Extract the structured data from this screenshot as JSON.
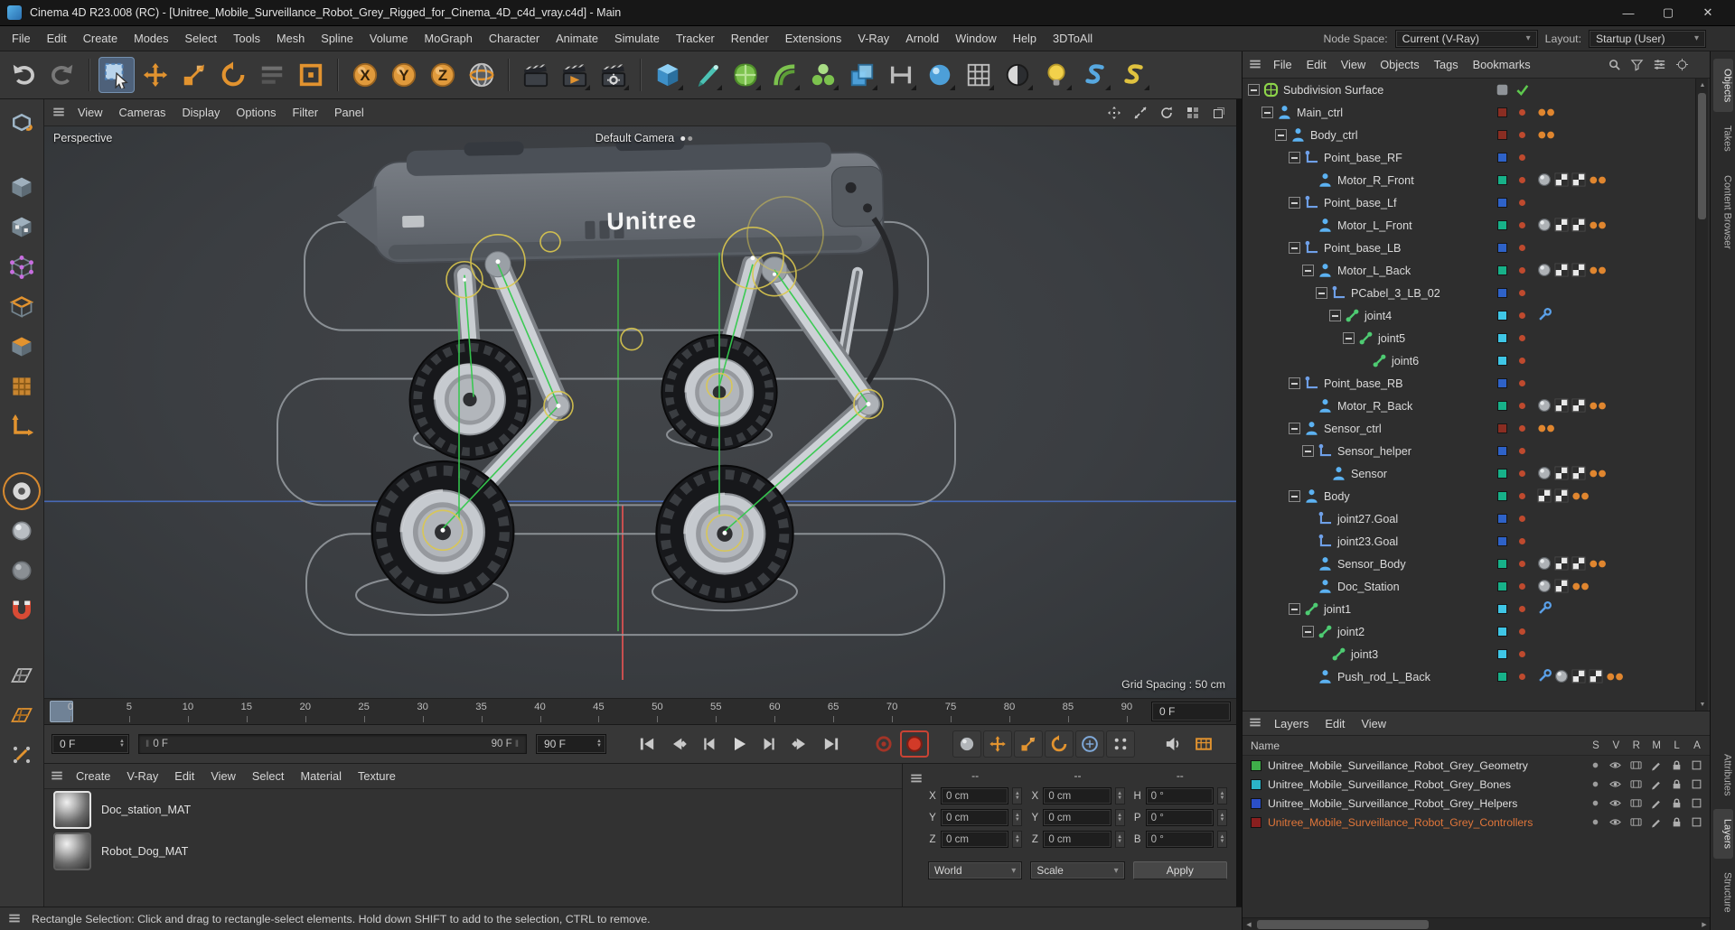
{
  "window": {
    "title": "Cinema 4D R23.008 (RC) - [Unitree_Mobile_Surveillance_Robot_Grey_Rigged_for_Cinema_4D_c4d_vray.c4d] - Main",
    "buttons": [
      {
        "name": "minimize",
        "glyph": "—"
      },
      {
        "name": "maximize",
        "glyph": "▢"
      },
      {
        "name": "close",
        "glyph": "✕"
      }
    ]
  },
  "menu_bar": {
    "items": [
      "File",
      "Edit",
      "Create",
      "Modes",
      "Select",
      "Tools",
      "Mesh",
      "Spline",
      "Volume",
      "MoGraph",
      "Character",
      "Animate",
      "Simulate",
      "Tracker",
      "Render",
      "Extensions",
      "V-Ray",
      "Arnold",
      "Window",
      "Help",
      "3DToAll"
    ],
    "node_space_label": "Node Space:",
    "node_space_value": "Current (V-Ray)",
    "layout_label": "Layout:",
    "layout_value": "Startup (User)"
  },
  "toolbar": {
    "tools": [
      {
        "name": "undo",
        "icon": "undo"
      },
      {
        "name": "redo",
        "icon": "redo"
      },
      {
        "sep": true
      },
      {
        "name": "live-selection",
        "icon": "live-selection",
        "selected": true
      },
      {
        "name": "move-tool",
        "icon": "move"
      },
      {
        "name": "scale-tool",
        "icon": "scale"
      },
      {
        "name": "rotate-tool",
        "icon": "rotate"
      },
      {
        "name": "last-used-tool",
        "icon": "last-tool"
      },
      {
        "name": "workplane-tool",
        "icon": "workplane"
      },
      {
        "sep": true
      },
      {
        "name": "x-axis-lock",
        "icon": "axis",
        "letter": "X"
      },
      {
        "name": "y-axis-lock",
        "icon": "axis",
        "letter": "Y"
      },
      {
        "name": "z-axis-lock",
        "icon": "axis",
        "letter": "Z"
      },
      {
        "name": "coordinate-system",
        "icon": "globe"
      },
      {
        "sep": true
      },
      {
        "name": "render-view",
        "icon": "clapper"
      },
      {
        "name": "render-to-picture-viewer",
        "icon": "clapper-play",
        "menu": true
      },
      {
        "name": "edit-render-settings",
        "icon": "clapper-gear",
        "menu": true
      },
      {
        "sep": true
      },
      {
        "name": "add-cube-object",
        "icon": "cube",
        "menu": true
      },
      {
        "name": "pen-spline-tool",
        "icon": "pen",
        "menu": true
      },
      {
        "name": "subdivision-surface-object",
        "icon": "sds-green",
        "menu": true
      },
      {
        "name": "bend-deformer",
        "icon": "bend",
        "menu": true
      },
      {
        "name": "mograph-cloner",
        "icon": "cloner",
        "menu": true
      },
      {
        "name": "volume-builder",
        "icon": "volume",
        "menu": true
      },
      {
        "name": "tracker-tool",
        "icon": "hpipe",
        "menu": true
      },
      {
        "name": "simulate-dynamics",
        "icon": "ball",
        "menu": true
      },
      {
        "name": "array-object",
        "icon": "grid",
        "menu": true
      },
      {
        "name": "environment-object",
        "icon": "bw-ball",
        "menu": true
      },
      {
        "name": "light-object",
        "icon": "bulb",
        "menu": true
      },
      {
        "name": "python-script",
        "icon": "py1",
        "menu": true
      },
      {
        "name": "xpresso-script",
        "icon": "py2",
        "menu": true
      }
    ]
  },
  "left_toolbar": {
    "tools": [
      {
        "name": "make-editable",
        "icon": "convert"
      },
      {
        "gap": true
      },
      {
        "name": "model-mode",
        "icon": "cube-solid"
      },
      {
        "name": "texture-mode",
        "icon": "cube-checker"
      },
      {
        "name": "points-mode",
        "icon": "cube-points"
      },
      {
        "name": "edges-mode",
        "icon": "cube-edges"
      },
      {
        "name": "polygons-mode",
        "icon": "cube-polys"
      },
      {
        "name": "uv-mode",
        "icon": "uv-grid"
      },
      {
        "name": "axis-mode",
        "icon": "l-axis"
      },
      {
        "gap": true
      },
      {
        "name": "viewport-solo",
        "icon": "solo",
        "selected": true
      },
      {
        "name": "snap-mode-a",
        "icon": "snap-ball"
      },
      {
        "name": "snap-mode-b",
        "icon": "snap-ball-dim"
      },
      {
        "name": "enable-snap",
        "icon": "magnet"
      },
      {
        "gap": true
      },
      {
        "name": "workplane-mode",
        "icon": "plane-grid"
      },
      {
        "name": "planar-workplane",
        "icon": "plane-orange"
      },
      {
        "name": "quantize",
        "icon": "quantize"
      }
    ]
  },
  "viewport": {
    "menu": [
      "View",
      "Cameras",
      "Display",
      "Options",
      "Filter",
      "Panel"
    ],
    "nav_icons": [
      "pan-view",
      "zoom-view",
      "rotate-view",
      "toggle-views",
      "detach-view"
    ],
    "view_label": "Perspective",
    "camera_label": "Default Camera",
    "grid_spacing": "Grid Spacing : 50 cm",
    "logo_text": "Unitree"
  },
  "timeline": {
    "ticks": [
      "0",
      "5",
      "10",
      "15",
      "20",
      "25",
      "30",
      "35",
      "40",
      "45",
      "50",
      "55",
      "60",
      "65",
      "70",
      "75",
      "80",
      "85",
      "90"
    ],
    "ruler_frame_field": "0 F",
    "current_frame": "0 F",
    "range_start": "0 F",
    "range_end": "90 F",
    "end_frame": "90 F",
    "transport": [
      {
        "name": "go-to-start",
        "icon": "skip-start"
      },
      {
        "name": "go-to-previous-key",
        "icon": "prev-key"
      },
      {
        "name": "go-to-previous-frame",
        "icon": "prev-frame"
      },
      {
        "name": "play-forwards",
        "icon": "play"
      },
      {
        "name": "go-to-next-frame",
        "icon": "next-frame"
      },
      {
        "name": "go-to-next-key",
        "icon": "next-key"
      },
      {
        "name": "go-to-end",
        "icon": "skip-end"
      },
      {
        "gap": true
      },
      {
        "name": "record-active-objects",
        "icon": "record"
      },
      {
        "name": "autokeying",
        "icon": "autokey",
        "selected": true
      },
      {
        "gap": true
      },
      {
        "name": "keyframe-selection",
        "icon": "key-ball",
        "group": true
      },
      {
        "name": "record-position",
        "icon": "rec-pos",
        "group": true
      },
      {
        "name": "record-scale",
        "icon": "rec-scale",
        "group": true
      },
      {
        "name": "record-rotation",
        "icon": "rec-rot",
        "group": true
      },
      {
        "name": "record-parameter",
        "icon": "rec-param",
        "group": true
      },
      {
        "name": "record-point-level",
        "icon": "rec-pla",
        "group": true
      },
      {
        "gap": true
      },
      {
        "name": "play-sound",
        "icon": "sound"
      },
      {
        "name": "hud-toggle",
        "icon": "hud"
      }
    ]
  },
  "materials": {
    "menu": [
      "Create",
      "V-Ray",
      "Edit",
      "View",
      "Select",
      "Material",
      "Texture"
    ],
    "items": [
      {
        "name": "Doc_station_MAT",
        "selected": true
      },
      {
        "name": "Robot_Dog_MAT",
        "selected": false
      }
    ]
  },
  "coordinates": {
    "columns": [
      {
        "header": "--",
        "rows": [
          {
            "label": "X",
            "value": "0 cm"
          },
          {
            "label": "Y",
            "value": "0 cm"
          },
          {
            "label": "Z",
            "value": "0 cm"
          }
        ],
        "footer": {
          "type": "select",
          "value": "World"
        }
      },
      {
        "header": "--",
        "rows": [
          {
            "label": "X",
            "value": "0 cm"
          },
          {
            "label": "Y",
            "value": "0 cm"
          },
          {
            "label": "Z",
            "value": "0 cm"
          }
        ],
        "footer": {
          "type": "select",
          "value": "Scale"
        }
      },
      {
        "header": "--",
        "rows": [
          {
            "label": "H",
            "value": "0 °"
          },
          {
            "label": "P",
            "value": "0 °"
          },
          {
            "label": "B",
            "value": "0 °"
          }
        ],
        "footer": {
          "type": "button",
          "value": "Apply"
        }
      }
    ]
  },
  "object_manager": {
    "menu": [
      "File",
      "Edit",
      "View",
      "Objects",
      "Tags",
      "Bookmarks"
    ],
    "header_icons": [
      "search",
      "filter",
      "view-options",
      "target"
    ],
    "rows": [
      {
        "label": "Subdivision Surface",
        "level": 0,
        "icon": "sds",
        "expander": true,
        "state": [
          "layer-grey",
          "check-green"
        ]
      },
      {
        "label": "Main_ctrl",
        "level": 1,
        "icon": "person",
        "expander": true,
        "swatch": "#8a2d22",
        "dot": "#bf4a2e",
        "tags": [
          "anim-dots"
        ]
      },
      {
        "label": "Body_ctrl",
        "level": 2,
        "icon": "person",
        "expander": true,
        "swatch": "#8a2d22",
        "dot": "#bf4a2e",
        "tags": [
          "anim-dots"
        ]
      },
      {
        "label": "Point_base_RF",
        "level": 3,
        "icon": "null",
        "expander": true,
        "swatch": "#2e62c8",
        "dot": "#bf4a2e",
        "tags": []
      },
      {
        "label": "Motor_R_Front",
        "level": 4,
        "icon": "person",
        "expander": false,
        "swatch": "#17b189",
        "dot": "#bf4a2e",
        "tags": [
          "texture-tag",
          "checker-tag",
          "checker-tag",
          "anim-dots"
        ]
      },
      {
        "label": "Point_base_Lf",
        "level": 3,
        "icon": "null",
        "expander": true,
        "swatch": "#2e62c8",
        "dot": "#bf4a2e",
        "tags": []
      },
      {
        "label": "Motor_L_Front",
        "level": 4,
        "icon": "person",
        "expander": false,
        "swatch": "#17b189",
        "dot": "#bf4a2e",
        "tags": [
          "texture-tag",
          "checker-tag",
          "checker-tag",
          "anim-dots"
        ]
      },
      {
        "label": "Point_base_LB",
        "level": 3,
        "icon": "null",
        "expander": true,
        "swatch": "#2e62c8",
        "dot": "#bf4a2e",
        "tags": []
      },
      {
        "label": "Motor_L_Back",
        "level": 4,
        "icon": "person",
        "expander": true,
        "swatch": "#17b189",
        "dot": "#bf4a2e",
        "tags": [
          "texture-tag",
          "checker-tag",
          "checker-tag",
          "anim-dots"
        ]
      },
      {
        "label": "PCabel_3_LB_02",
        "level": 5,
        "icon": "null",
        "expander": true,
        "swatch": "#2e62c8",
        "dot": "#bf4a2e",
        "tags": []
      },
      {
        "label": "joint4",
        "level": 6,
        "icon": "joint",
        "expander": true,
        "swatch": "#3fc6e6",
        "dot": "#bf4a2e",
        "tags": [
          "ik-tag"
        ]
      },
      {
        "label": "joint5",
        "level": 7,
        "icon": "joint",
        "expander": true,
        "swatch": "#3fc6e6",
        "dot": "#bf4a2e",
        "tags": []
      },
      {
        "label": "joint6",
        "level": 8,
        "icon": "joint",
        "expander": false,
        "swatch": "#3fc6e6",
        "dot": "#bf4a2e",
        "tags": []
      },
      {
        "label": "Point_base_RB",
        "level": 3,
        "icon": "null",
        "expander": true,
        "swatch": "#2e62c8",
        "dot": "#bf4a2e",
        "tags": []
      },
      {
        "label": "Motor_R_Back",
        "level": 4,
        "icon": "person",
        "expander": false,
        "swatch": "#17b189",
        "dot": "#bf4a2e",
        "tags": [
          "texture-tag",
          "checker-tag",
          "checker-tag",
          "anim-dots"
        ]
      },
      {
        "label": "Sensor_ctrl",
        "level": 3,
        "icon": "person",
        "expander": true,
        "swatch": "#8a2d22",
        "dot": "#bf4a2e",
        "tags": [
          "anim-dots"
        ]
      },
      {
        "label": "Sensor_helper",
        "level": 4,
        "icon": "null",
        "expander": true,
        "swatch": "#2e62c8",
        "dot": "#bf4a2e",
        "tags": []
      },
      {
        "label": "Sensor",
        "level": 5,
        "icon": "person",
        "expander": false,
        "swatch": "#17b189",
        "dot": "#bf4a2e",
        "tags": [
          "texture-tag",
          "checker-tag",
          "checker-tag",
          "anim-dots"
        ]
      },
      {
        "label": "Body",
        "level": 3,
        "icon": "person",
        "expander": true,
        "swatch": "#17b189",
        "dot": "#bf4a2e",
        "tags": [
          "checker-tag",
          "checker-tag",
          "anim-dots"
        ]
      },
      {
        "label": "joint27.Goal",
        "level": 4,
        "icon": "null",
        "expander": false,
        "swatch": "#2e62c8",
        "dot": "#bf4a2e",
        "tags": []
      },
      {
        "label": "joint23.Goal",
        "level": 4,
        "icon": "null",
        "expander": false,
        "swatch": "#2e62c8",
        "dot": "#bf4a2e",
        "tags": []
      },
      {
        "label": "Sensor_Body",
        "level": 4,
        "icon": "person",
        "expander": false,
        "swatch": "#17b189",
        "dot": "#bf4a2e",
        "tags": [
          "texture-tag",
          "checker-tag",
          "checker-tag",
          "anim-dots"
        ]
      },
      {
        "label": "Doc_Station",
        "level": 4,
        "icon": "person",
        "expander": false,
        "swatch": "#17b189",
        "dot": "#bf4a2e",
        "tags": [
          "texture-tag",
          "checker-tag",
          "anim-dots"
        ]
      },
      {
        "label": "joint1",
        "level": 3,
        "icon": "joint",
        "expander": true,
        "swatch": "#3fc6e6",
        "dot": "#bf4a2e",
        "tags": [
          "ik-tag"
        ]
      },
      {
        "label": "joint2",
        "level": 4,
        "icon": "joint",
        "expander": true,
        "swatch": "#3fc6e6",
        "dot": "#bf4a2e",
        "tags": []
      },
      {
        "label": "joint3",
        "level": 5,
        "icon": "joint",
        "expander": false,
        "swatch": "#3fc6e6",
        "dot": "#bf4a2e",
        "tags": []
      },
      {
        "label": "Push_rod_L_Back",
        "level": 4,
        "icon": "person",
        "expander": false,
        "swatch": "#17b189",
        "dot": "#bf4a2e",
        "tags": [
          "ik-tag",
          "texture-tag",
          "checker-tag",
          "checker-tag",
          "anim-dots"
        ]
      }
    ]
  },
  "layers_panel": {
    "menu": [
      "Layers",
      "Edit",
      "View"
    ],
    "name_header": "Name",
    "column_headers": [
      "S",
      "V",
      "R",
      "M",
      "L",
      "A"
    ],
    "layers": [
      {
        "name": "Unitree_Mobile_Surveillance_Robot_Grey_Geometry",
        "color": "#3fae49",
        "selected": false
      },
      {
        "name": "Unitree_Mobile_Surveillance_Robot_Grey_Bones",
        "color": "#2bb3c8",
        "selected": false
      },
      {
        "name": "Unitree_Mobile_Surveillance_Robot_Grey_Helpers",
        "color": "#2b4fc8",
        "selected": false
      },
      {
        "name": "Unitree_Mobile_Surveillance_Robot_Grey_Controllers",
        "color": "#8a1f1f",
        "selected": true
      }
    ]
  },
  "side_tabs": {
    "top": [
      "Objects",
      "Takes",
      "Content Browser"
    ],
    "bottom": [
      "Attributes",
      "Layers",
      "Structure"
    ]
  },
  "status_bar": {
    "text": "Rectangle Selection: Click and drag to rectangle-select elements. Hold down SHIFT to add to the selection, CTRL to remove."
  }
}
